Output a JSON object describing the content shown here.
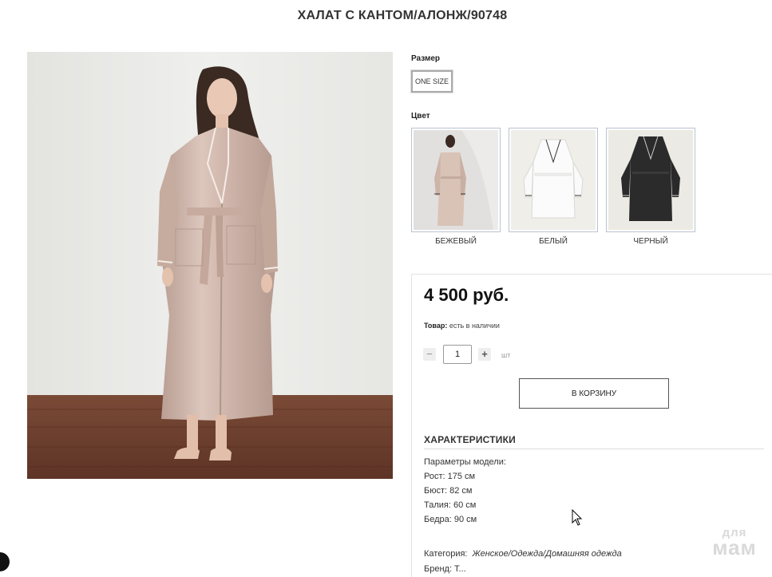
{
  "product": {
    "title": "ХАЛАТ С КАНТОМ/АЛОНЖ/90748",
    "main_photo_icon": "model-in-beige-robe-photo"
  },
  "size": {
    "label": "Размер",
    "option": "ONE SIZE"
  },
  "color": {
    "label": "Цвет",
    "options": [
      {
        "name": "БЕЖЕВЫЙ",
        "hex": "#d7c2b6"
      },
      {
        "name": "БЕЛЫЙ",
        "hex": "#f7f7f5"
      },
      {
        "name": "ЧЕРНЫЙ",
        "hex": "#2a2a2a"
      }
    ]
  },
  "purchase": {
    "price": "4 500 руб.",
    "stock_label": "Товар:",
    "stock_value": "есть в наличии",
    "quantity": "1",
    "minus": "−",
    "plus": "+",
    "unit": "шт",
    "cart_button": "В КОРЗИНУ"
  },
  "specs": {
    "title": "ХАРАКТЕРИСТИКИ",
    "lines": [
      "Параметры модели:",
      "Рост: 175 см",
      "Бюст: 82 см",
      "Талия: 60 см",
      "Бедра: 90 см"
    ],
    "category_label": "Категория:",
    "category_value": "Женское/Одежда/Домашняя одежда",
    "brand_partial": "Бренд: Т..."
  },
  "watermark": {
    "top": "для",
    "bottom": "мам"
  }
}
